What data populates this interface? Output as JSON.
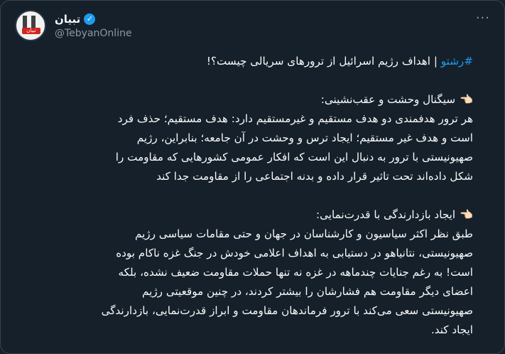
{
  "account": {
    "display_name": "تبیان",
    "handle": "@TebyanOnline",
    "avatar_text": "تبیان",
    "verified_icon": "✓",
    "more_icon": "···"
  },
  "tweet": {
    "hashtag": "#رشتو",
    "title_rest": " | اهداف رژیم اسرائیل از ترورهای سریالی چیست؟!",
    "pointer_emoji": "👈🏻",
    "s1_heading": "سیگنال وحشت و عقب‌نشینی:",
    "s1_line1": "هر ترور هدفمندی دو هدف مستقیم و غیرمستقیم دارد: هدف مستقیم؛ حذف فرد",
    "s1_line2": "است و هدف غیر مستقیم؛ ایجاد ترس و وحشت در آن جامعه؛ بنابراین، رژیم",
    "s1_line3": "صهیونیستی با ترور به دنبال این است که افکار عمومی کشورهایی که مقاومت را",
    "s1_line4": "شکل داده‌اند تحت تاثیر قرار داده و بدنه اجتماعی را از مقاومت جدا کند",
    "s2_heading": "ایجاد بازدارندگی با قدرت‌نمایی:",
    "s2_line1": "طبق نظر اکثر سیاسیون و کارشناسان در جهان و حتی مقامات سیاسی رژیم",
    "s2_line2": "صهیونیستی، نتانیاهو در دستیابی به اهداف اعلامی خودش در جنگ غزه ناکام بوده",
    "s2_line3": "است! به رغم جنایات چندماهه در غزه نه تنها حملات مقاومت ضعیف نشده، بلکه",
    "s2_line4": "اعضای دیگر مقاومت هم فشارشان را بیشتر کردند، در چنین موقعیتی رژیم",
    "s2_line5": "صهیونیستی سعی می‌کند با ترور فرماندهان مقاومت و ابراز قدرت‌نمایی، بازدارندگی",
    "s2_line6": "ایجاد کند."
  },
  "colors": {
    "background": "#15202b",
    "text": "#f7f9f9",
    "secondary": "#8b98a5",
    "accent": "#1d9bf0"
  }
}
